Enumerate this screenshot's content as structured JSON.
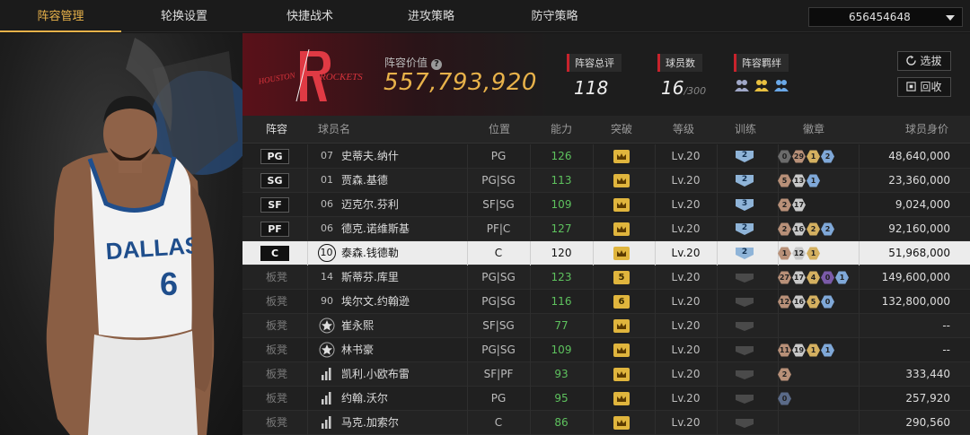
{
  "tabs": [
    {
      "label": "阵容管理",
      "active": true
    },
    {
      "label": "轮换设置",
      "active": false
    },
    {
      "label": "快捷战术",
      "active": false
    },
    {
      "label": "进攻策略",
      "active": false
    },
    {
      "label": "防守策略",
      "active": false
    }
  ],
  "account": {
    "id": "656454648"
  },
  "team": {
    "logo_name": "HOUSTON ROCKETS",
    "value_label": "阵容价值",
    "value": "557,793,920",
    "overall_label": "阵容总评",
    "overall": "118",
    "count_label": "球员数",
    "count": "16",
    "count_max": "/300",
    "bond_label": "阵容羁绊"
  },
  "buttons": {
    "pick": "选拔",
    "recycle": "回收"
  },
  "columns": {
    "lineup": "阵容",
    "name": "球员名",
    "position": "位置",
    "ability": "能力",
    "breakthrough": "突破",
    "level": "等级",
    "training": "训练",
    "badges": "徽章",
    "worth": "球员身价"
  },
  "colors": {
    "accent": "#e8b24a",
    "green": "#5ec25e",
    "red": "#c8232c"
  },
  "rows": [
    {
      "slot": "PG",
      "starter": true,
      "jersey": "07",
      "name": "史蒂夫.纳什",
      "pos": "PG",
      "ability": "126",
      "break_icon": "crown-icon",
      "level": "Lv.20",
      "train": "2",
      "badges": [
        {
          "t": "0",
          "c": "#6b6b6b"
        },
        {
          "t": "29",
          "c": "#b89078"
        },
        {
          "t": "1",
          "c": "#d4b060"
        },
        {
          "t": "2",
          "c": "#7fa8d8"
        }
      ],
      "worth": "48,640,000",
      "ab_green": true
    },
    {
      "slot": "SG",
      "starter": true,
      "jersey": "01",
      "name": "贾森.基德",
      "pos": "PG|SG",
      "ability": "113",
      "break_icon": "crown-icon",
      "level": "Lv.20",
      "train": "2",
      "badges": [
        {
          "t": "5",
          "c": "#b89078"
        },
        {
          "t": "13",
          "c": "#c8c8c8"
        },
        {
          "t": "1",
          "c": "#7fa8d8"
        }
      ],
      "worth": "23,360,000",
      "ab_green": true
    },
    {
      "slot": "SF",
      "starter": true,
      "jersey": "06",
      "name": "迈克尔.芬利",
      "pos": "SF|SG",
      "ability": "109",
      "break_icon": "crown-icon",
      "level": "Lv.20",
      "train": "3",
      "badges": [
        {
          "t": "2",
          "c": "#b89078"
        },
        {
          "t": "17",
          "c": "#c8c8c8"
        }
      ],
      "worth": "9,024,000",
      "ab_green": true
    },
    {
      "slot": "PF",
      "starter": true,
      "jersey": "06",
      "name": "德克.诺维斯基",
      "pos": "PF|C",
      "ability": "127",
      "break_icon": "crown-icon",
      "level": "Lv.20",
      "train": "2",
      "badges": [
        {
          "t": "2",
          "c": "#b89078"
        },
        {
          "t": "16",
          "c": "#c8c8c8"
        },
        {
          "t": "2",
          "c": "#d4b060"
        },
        {
          "t": "2",
          "c": "#7fa8d8"
        }
      ],
      "worth": "92,160,000",
      "ab_green": true
    },
    {
      "slot": "C",
      "starter": true,
      "selected": true,
      "jersey": "10",
      "name": "泰森.钱德勒",
      "pos": "C",
      "ability": "120",
      "break_icon": "crown-icon",
      "level": "Lv.20",
      "train": "2",
      "badges": [
        {
          "t": "1",
          "c": "#b89078"
        },
        {
          "t": "12",
          "c": "#c8c8c8"
        },
        {
          "t": "1",
          "c": "#d4b060"
        }
      ],
      "worth": "51,968,000",
      "ab_green": false
    },
    {
      "slot": "板凳",
      "starter": false,
      "jersey": "14",
      "name": "斯蒂芬.库里",
      "pos": "PG|SG",
      "ability": "123",
      "break_icon": "5",
      "level": "Lv.20",
      "train": "",
      "badges": [
        {
          "t": "27",
          "c": "#b89078"
        },
        {
          "t": "17",
          "c": "#c8c8c8"
        },
        {
          "t": "4",
          "c": "#d4b060"
        },
        {
          "t": "0",
          "c": "#7a5aa8"
        },
        {
          "t": "1",
          "c": "#7fa8d8"
        }
      ],
      "worth": "149,600,000",
      "ab_green": true
    },
    {
      "slot": "板凳",
      "starter": false,
      "jersey": "90",
      "name": "埃尔文.约翰逊",
      "pos": "PG|SG",
      "ability": "116",
      "break_icon": "6",
      "level": "Lv.20",
      "train": "",
      "badges": [
        {
          "t": "12",
          "c": "#b89078"
        },
        {
          "t": "16",
          "c": "#c8c8c8"
        },
        {
          "t": "5",
          "c": "#d4b060"
        },
        {
          "t": "0",
          "c": "#7fa8d8"
        }
      ],
      "worth": "132,800,000",
      "ab_green": true
    },
    {
      "slot": "板凳",
      "starter": false,
      "jersey": "☆",
      "name": "崔永熙",
      "pos": "SF|SG",
      "ability": "77",
      "break_icon": "crown-icon",
      "level": "Lv.20",
      "train": "",
      "badges": [],
      "worth": "--",
      "ab_green": true
    },
    {
      "slot": "板凳",
      "starter": false,
      "jersey": "☆",
      "name": "林书豪",
      "pos": "PG|SG",
      "ability": "109",
      "break_icon": "crown-icon",
      "level": "Lv.20",
      "train": "",
      "badges": [
        {
          "t": "11",
          "c": "#b89078"
        },
        {
          "t": "19",
          "c": "#c8c8c8"
        },
        {
          "t": "1",
          "c": "#d4b060"
        },
        {
          "t": "1",
          "c": "#7fa8d8"
        }
      ],
      "worth": "--",
      "ab_green": true
    },
    {
      "slot": "板凳",
      "starter": false,
      "jersey": "bars",
      "name": "凯利.小欧布雷",
      "pos": "SF|PF",
      "ability": "93",
      "break_icon": "crown-icon",
      "level": "Lv.20",
      "train": "",
      "badges": [
        {
          "t": "2",
          "c": "#b89078"
        }
      ],
      "worth": "333,440",
      "ab_green": true
    },
    {
      "slot": "板凳",
      "starter": false,
      "jersey": "bars",
      "name": "约翰.沃尔",
      "pos": "PG",
      "ability": "95",
      "break_icon": "crown-icon",
      "level": "Lv.20",
      "train": "",
      "badges": [
        {
          "t": "0",
          "c": "#5a6a88"
        }
      ],
      "worth": "257,920",
      "ab_green": true
    },
    {
      "slot": "板凳",
      "starter": false,
      "jersey": "bars",
      "name": "马克.加索尔",
      "pos": "C",
      "ability": "86",
      "break_icon": "crown-icon",
      "level": "Lv.20",
      "train": "",
      "badges": [],
      "worth": "290,560",
      "ab_green": true
    }
  ]
}
